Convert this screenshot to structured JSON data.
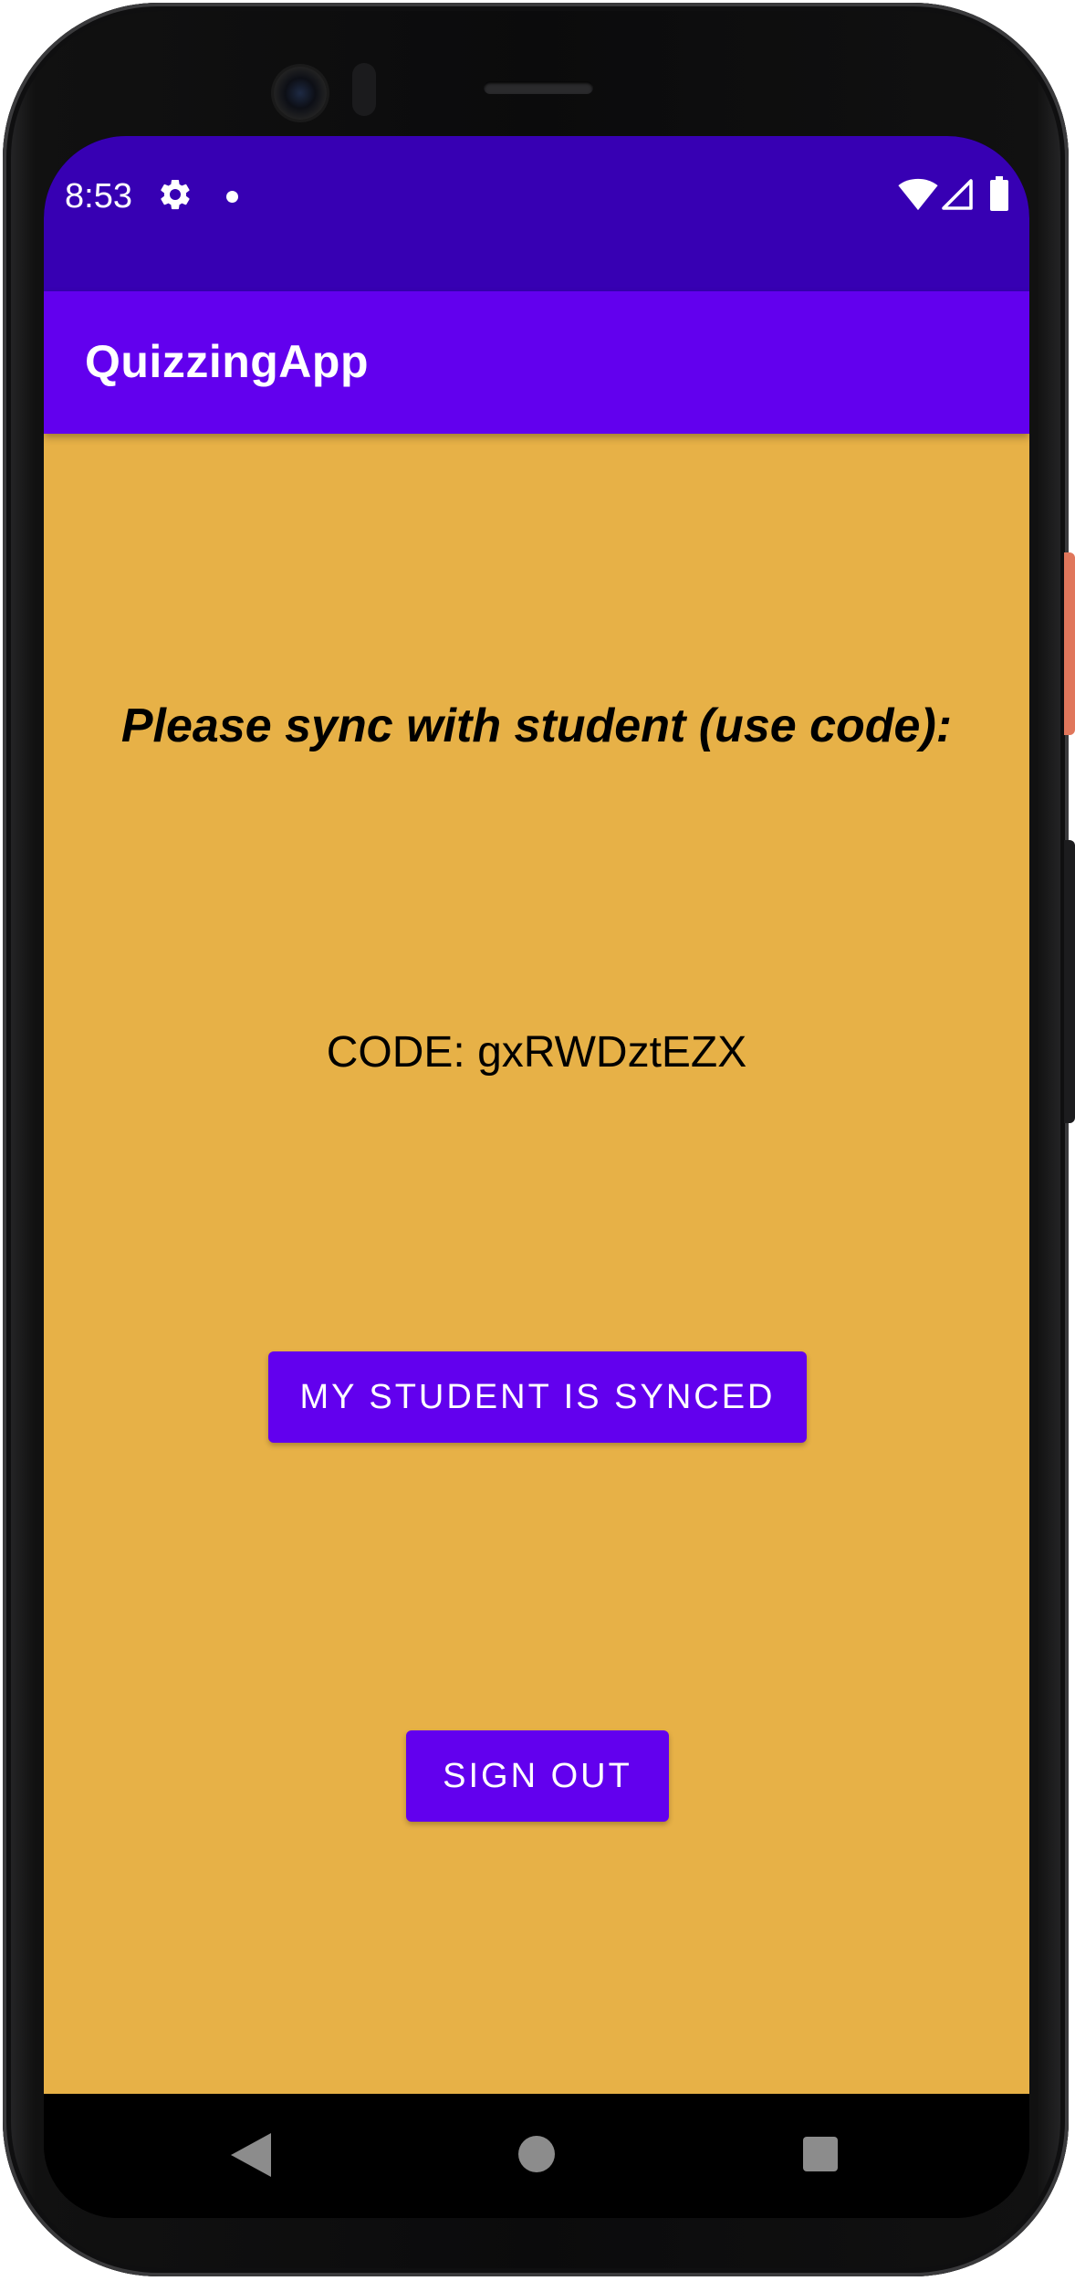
{
  "status_bar": {
    "time": "8:53",
    "icons": [
      "gear-icon",
      "notification-dot-icon",
      "wifi-icon",
      "signal-icon",
      "battery-icon"
    ],
    "background": "#3700b3"
  },
  "app_bar": {
    "title": "QuizzingApp",
    "background": "#6200ee"
  },
  "main": {
    "background": "#e7b147",
    "prompt": "Please sync with student (use code):",
    "code_text": "CODE: gxRWDztEZX",
    "synced_button_label": "MY STUDENT IS SYNCED",
    "sign_out_button_label": "SIGN OUT",
    "button_color": "#6200ee"
  },
  "nav_bar": {
    "icons": [
      "back-icon",
      "home-icon",
      "recents-icon"
    ]
  }
}
